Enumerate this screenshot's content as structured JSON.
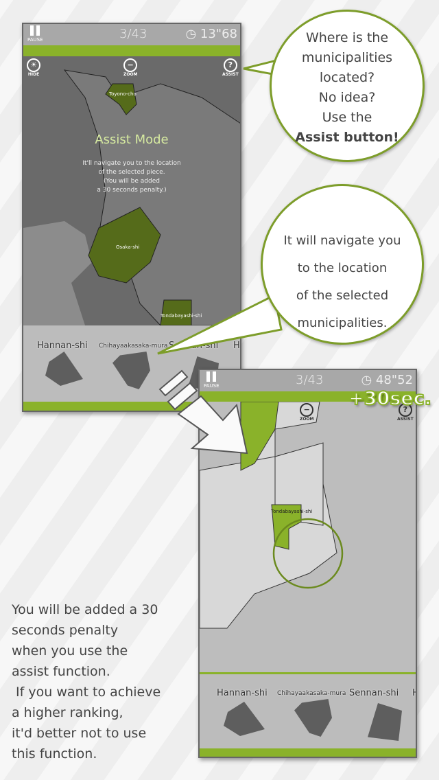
{
  "screen1": {
    "pause_label": "PAUSE",
    "counter": "3/43",
    "timer": "13\"68",
    "hide_label": "HIDE",
    "zoom_label": "ZOOM",
    "assist_label": "ASSIST",
    "map_labels": [
      "Toyono-cho",
      "Osaka-shi",
      "Tondabayashi-shi"
    ],
    "overlay_title": "Assist Mode",
    "overlay_lines": [
      "It'll navigate you to the location",
      "of the selected piece.",
      "(You will be added",
      "a 30 seconds penalty.)"
    ],
    "pieces": [
      "Hannan-shi",
      "Chihayaakasaka-mura",
      "Sennan-shi",
      "H"
    ]
  },
  "screen2": {
    "pause_label": "PAUSE",
    "counter": "3/43",
    "timer": "48\"52",
    "zoom_label": "ZOOM",
    "assist_label": "ASSIST",
    "penalty": "+30sec.",
    "map_labels": [
      "Tondabayashi-shi"
    ],
    "pieces": [
      "Hannan-shi",
      "Chihayaakasaka-mura",
      "Sennan-shi",
      "H"
    ]
  },
  "bubble1": {
    "lines": [
      "Where is the",
      "municipalities",
      "located?",
      "No idea?",
      "Use the"
    ],
    "bold": "Assist button!"
  },
  "bubble2": {
    "lines": [
      "It will navigate you",
      "to the location",
      "of the selected",
      "municipalities."
    ]
  },
  "caption": "You will be added a 30\nseconds penalty\nwhen you use the\nassist function.\n If you want to achieve\na higher ranking,\nit'd better not to use\nthis function.",
  "colors": {
    "accent": "#8ab22a",
    "highlight": "#6b8a1e"
  }
}
